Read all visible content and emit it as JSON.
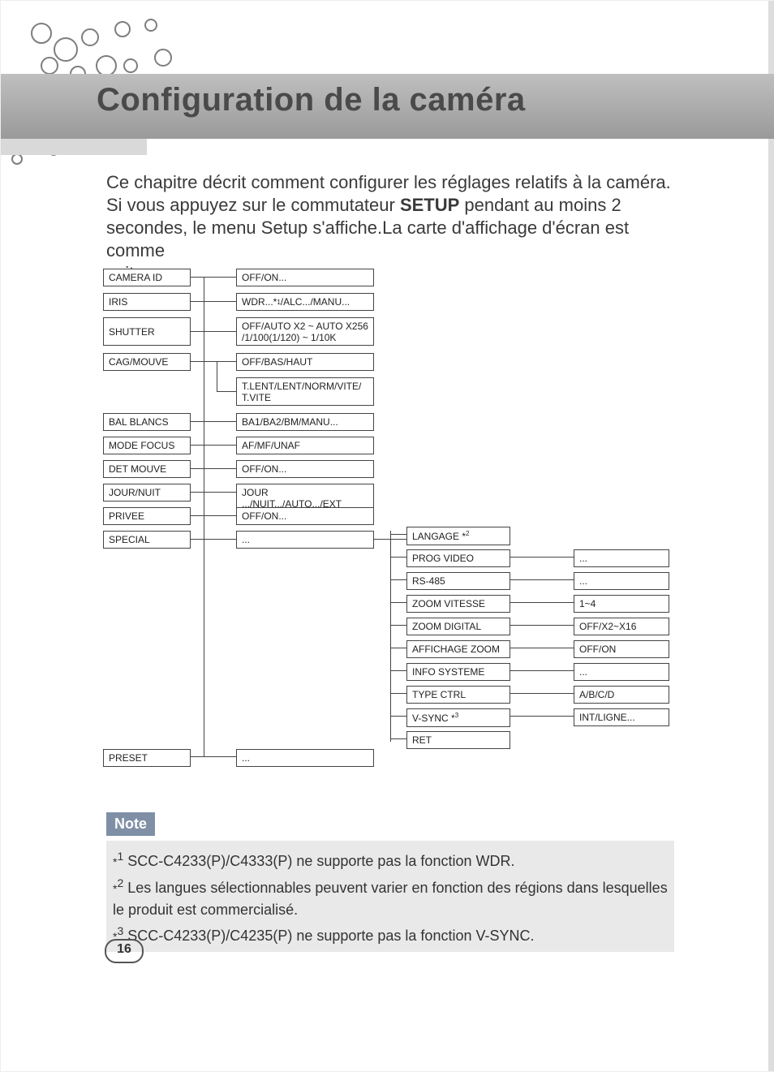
{
  "header": {
    "title": "Configuration de la caméra"
  },
  "intro": {
    "line1": "Ce chapitre décrit comment configurer les réglages relatifs à la caméra.",
    "line2a": "Si vous appuyez sur le commutateur ",
    "line2b": "SETUP",
    "line2c": " pendant au moins 2",
    "line3": "secondes, le menu Setup s'affiche.La carte d'affichage d'écran est comme",
    "line4": "suit :"
  },
  "menu": {
    "camera_id": {
      "label": "CAMERA ID",
      "value": "OFF/ON..."
    },
    "iris": {
      "label": "IRIS",
      "value_pre": "WDR...*",
      "value_sup": "1",
      "value_post": "/ALC.../MANU..."
    },
    "shutter": {
      "label": "SHUTTER",
      "value_l1": "OFF/AUTO X2 ~ AUTO X256",
      "value_l2": "/1/100(1/120) ~ 1/10K"
    },
    "cag": {
      "label": "CAG/MOUVE",
      "value": "OFF/BAS/HAUT",
      "extra_l1": "T.LENT/LENT/NORM/VITE/",
      "extra_l2": "T.VITE"
    },
    "bal": {
      "label": "BAL BLANCS",
      "value": "BA1/BA2/BM/MANU..."
    },
    "focus": {
      "label": "MODE FOCUS",
      "value": "AF/MF/UNAF"
    },
    "det": {
      "label": "DET MOUVE",
      "value": "OFF/ON..."
    },
    "daynight": {
      "label": "JOUR/NUIT",
      "value": "JOUR .../NUIT.../AUTO.../EXT"
    },
    "privee": {
      "label": "PRIVEE",
      "value": "OFF/ON..."
    },
    "special": {
      "label": "SPECIAL",
      "value": "..."
    },
    "preset": {
      "label": "PRESET",
      "value": "..."
    }
  },
  "special_sub": {
    "langage": {
      "label_pre": "LANGAGE *",
      "label_sup": "2"
    },
    "progvideo": {
      "label": "PROG VIDEO",
      "value": "..."
    },
    "rs485": {
      "label": "RS-485",
      "value": "..."
    },
    "zoomvit": {
      "label": "ZOOM VITESSE",
      "value": "1~4"
    },
    "zoomdig": {
      "label": "ZOOM DIGITAL",
      "value": "OFF/X2~X16"
    },
    "affzoom": {
      "label": "AFFICHAGE ZOOM",
      "value": "OFF/ON"
    },
    "infosys": {
      "label": "INFO SYSTEME",
      "value": "..."
    },
    "typectrl": {
      "label": "TYPE CTRL",
      "value": "A/B/C/D"
    },
    "vsync": {
      "label_pre": "V-SYNC *",
      "label_sup": "3",
      "value": "INT/LIGNE..."
    },
    "ret": {
      "label": "RET"
    }
  },
  "note": {
    "badge": "Note",
    "n1": " SCC-C4233(P)/C4333(P) ne supporte pas la fonction WDR.",
    "n2": " Les langues sélectionnables peuvent varier en fonction des régions dans lesquelles le produit est commercialisé.",
    "n3": " SCC-C4233(P)/C4235(P) ne supporte pas la fonction V-SYNC.",
    "a1": "*",
    "s1": "1",
    "a2": "*",
    "s2": "2",
    "a3": "*",
    "s3": "3"
  },
  "page_number": "16"
}
